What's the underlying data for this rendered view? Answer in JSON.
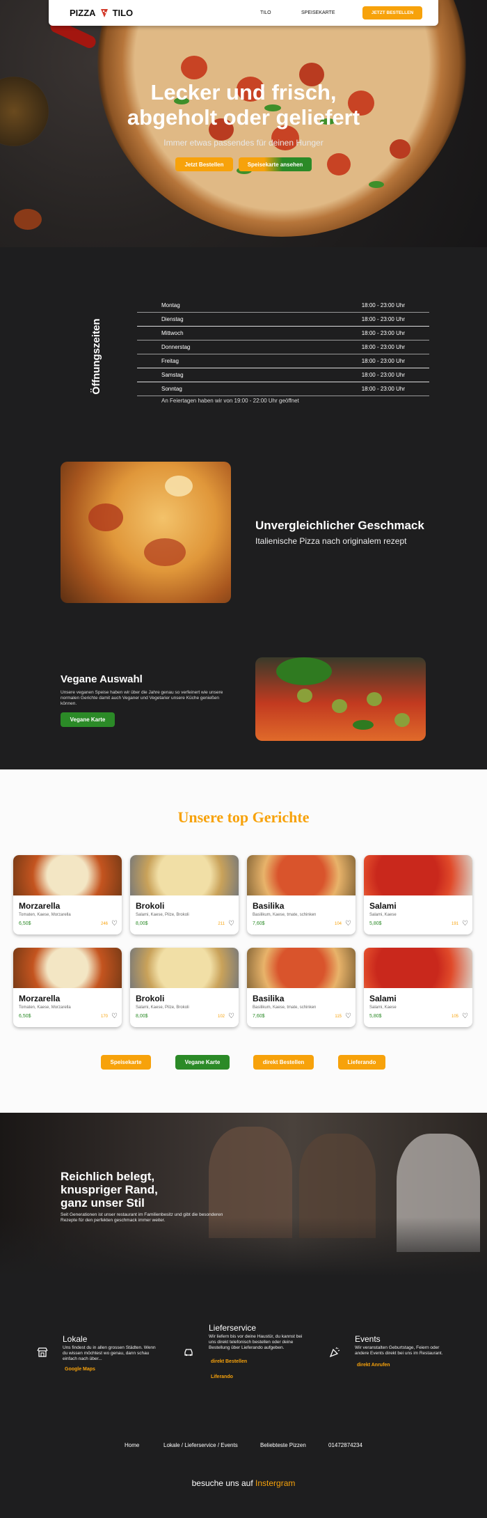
{
  "nav": {
    "logo_left": "PIZZA",
    "logo_right": "TILO",
    "links": [
      "TILO",
      "SPEISEKARTE"
    ],
    "cta": "JETZT BESTELLEN"
  },
  "hero": {
    "title_line1": "Lecker und frisch,",
    "title_line2": "abgeholt oder geliefert",
    "subtitle": "Immer etwas passendes für deinen Hunger",
    "btn_order": "Jetzt Bestellen",
    "btn_menu": "Speisekarte ansehen"
  },
  "hours": {
    "heading": "Öffnungszeiten",
    "rows": [
      {
        "day": "Montag",
        "time": "18:00 - 23:00 Uhr"
      },
      {
        "day": "Dienstag",
        "time": "18:00 - 23:00 Uhr"
      },
      {
        "day": "Mittwoch",
        "time": "18:00 - 23:00 Uhr"
      },
      {
        "day": "Donnerstag",
        "time": "18:00 - 23:00 Uhr"
      },
      {
        "day": "Freitag",
        "time": "18:00 - 23:00 Uhr"
      },
      {
        "day": "Samstag",
        "time": "18:00 - 23:00 Uhr"
      },
      {
        "day": "Sonntag",
        "time": "18:00 - 23:00 Uhr"
      }
    ],
    "note": "An Feiertagen haben wir von 19:00 - 22:00 Uhr geöffnet"
  },
  "taste": {
    "title": "Unvergleichlicher Geschmack",
    "subtitle": "Italienische Pizza nach originalem rezept"
  },
  "vegan": {
    "title": "Vegane Auswahl",
    "text": "Unsere veganen Speise haben wir über die Jahre genau so verfeinert wie unsere normalen Gerichte damit auch Veganer und Vegetarier unsere Küche genießen können.",
    "button": "Vegane Karte"
  },
  "top_dishes": {
    "title": "Unsere top Gerichte",
    "cards": [
      {
        "name": "Morzarella",
        "ingredients": "Tomaten, Kaese, Morzarella",
        "price": "6,50$",
        "likes": "246"
      },
      {
        "name": "Brokoli",
        "ingredients": "Salami, Kaese, Pilze, Brokoli",
        "price": "8,00$",
        "likes": "211"
      },
      {
        "name": "Basilika",
        "ingredients": "Basilikum, Kaese, tmate, schinken",
        "price": "7,60$",
        "likes": "104"
      },
      {
        "name": "Salami",
        "ingredients": "Salami, Kaese",
        "price": "5,80$",
        "likes": "191"
      },
      {
        "name": "Morzarella",
        "ingredients": "Tomaten, Kaese, Morzarella",
        "price": "6,50$",
        "likes": "170"
      },
      {
        "name": "Brokoli",
        "ingredients": "Salami, Kaese, Pilze, Brokoli",
        "price": "8,00$",
        "likes": "102"
      },
      {
        "name": "Basilika",
        "ingredients": "Basilikum, Kaese, tmate, schinken",
        "price": "7,60$",
        "likes": "115"
      },
      {
        "name": "Salami",
        "ingredients": "Salami, Kaese",
        "price": "5,80$",
        "likes": "105"
      }
    ],
    "buttons": [
      "Speisekarte",
      "Vegane Karte",
      "direkt Bestellen",
      "Lieferando"
    ]
  },
  "kitchen": {
    "title_line1": "Reichlich belegt,",
    "title_line2": "knuspriger Rand,",
    "title_line3": "ganz unser Stil",
    "text": "Seit Generationen ist unser restaurant im Familienbesitz und gibt die besonderen Rezepte für den perfekten geschmack immer weiter."
  },
  "services": [
    {
      "icon": "store-icon",
      "title": "Lokale",
      "text": "Uns findest du in allen grossen Städten. Wenn du wissen möchtest wo genau, dann schau einfach nach über...",
      "links": [
        "Google Maps"
      ]
    },
    {
      "icon": "car-icon",
      "title": "Lieferservice",
      "text": "Wir liefern bis vor deine Haustür, du kannst bei uns direkt telefonisch bestellen oder deine Bestellung über Lieferando aufgeben.",
      "links": [
        "direkt Bestellen",
        "Liferando"
      ]
    },
    {
      "icon": "party-icon",
      "title": "Events",
      "text": "Wir veranstalten Geburtstage, Feiern oder andere Events direkt bei uns im Restaurant.",
      "links": [
        "direkt Anrufen"
      ]
    }
  ],
  "footer": {
    "links": [
      "Home",
      "Lokale / Lieferservice / Events",
      "Beliebteste Pizzen",
      "01472874234"
    ],
    "visit_prefix": "besuche uns auf",
    "visit_link": "Instergram"
  },
  "colors": {
    "accent": "#f7a20b",
    "green": "#2b8a27",
    "dark": "#1e1e1f"
  }
}
